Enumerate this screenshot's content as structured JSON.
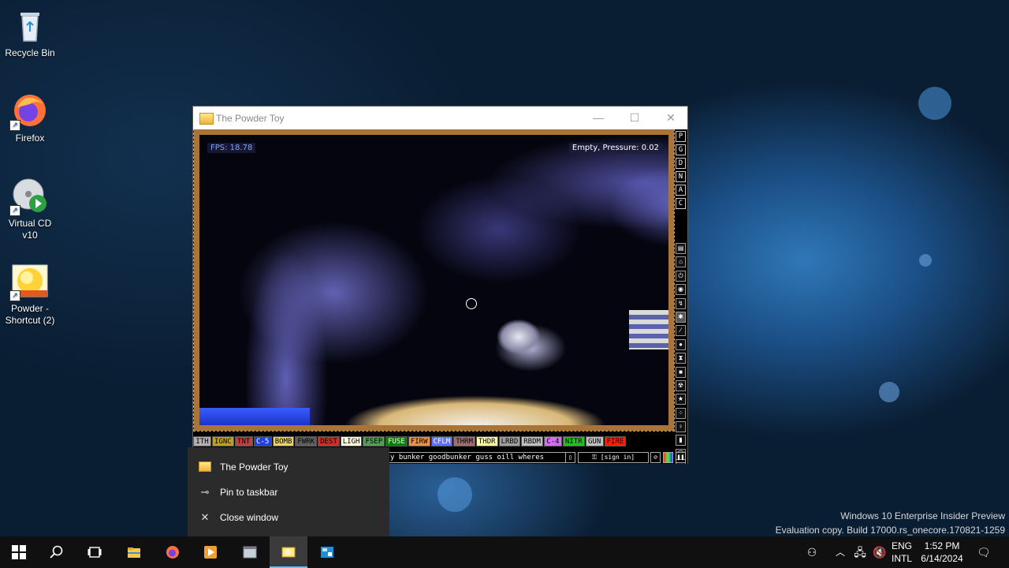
{
  "desktop": {
    "icons": [
      {
        "label": "Recycle Bin",
        "icon": "recycle-bin-icon"
      },
      {
        "label": "Firefox",
        "icon": "firefox-icon"
      },
      {
        "label": "Virtual CD v10",
        "icon": "virtual-cd-icon"
      },
      {
        "label": "Powder - Shortcut (2)",
        "icon": "powder-toy-icon"
      }
    ],
    "watermark": {
      "line1": "Windows 10 Enterprise Insider Preview",
      "line2": "Evaluation copy. Build 17000.rs_onecore.170821-1259"
    }
  },
  "window": {
    "title": "The Powder Toy",
    "controls": {
      "minimize": "—",
      "maximize": "☐",
      "close": "✕"
    }
  },
  "game": {
    "fps_label": "FPS: 18.78",
    "status_label": "Empty, Pressure: 0.02",
    "side_menu_top": [
      "P",
      "G",
      "D",
      "N",
      "A",
      "C"
    ],
    "categories": [
      "walls",
      "electronics",
      "powered",
      "sensors",
      "force",
      "explosives",
      "gases",
      "liquids",
      "powders",
      "solids",
      "radioactive",
      "special",
      "game-of-life",
      "tools",
      "favorites",
      "decorations",
      "search"
    ],
    "elements": [
      {
        "label": "ITH",
        "bg": "#b0b0b0",
        "fg": "#000000"
      },
      {
        "label": "IGNC",
        "bg": "#c0a020",
        "fg": "#000000"
      },
      {
        "label": "TNT",
        "bg": "#c04040",
        "fg": "#000000"
      },
      {
        "label": "C-5",
        "bg": "#2040e0",
        "fg": "#ffffff"
      },
      {
        "label": "BOMB",
        "bg": "#f0d060",
        "fg": "#000000"
      },
      {
        "label": "FWRK",
        "bg": "#606060",
        "fg": "#000000"
      },
      {
        "label": "DEST",
        "bg": "#d03020",
        "fg": "#000000"
      },
      {
        "label": "LIGH",
        "bg": "#ffffe0",
        "fg": "#000000"
      },
      {
        "label": "FSEP",
        "bg": "#50a050",
        "fg": "#000000"
      },
      {
        "label": "FUSE",
        "bg": "#008000",
        "fg": "#ffffff"
      },
      {
        "label": "FIRW",
        "bg": "#f09040",
        "fg": "#000000"
      },
      {
        "label": "CFLM",
        "bg": "#6070ff",
        "fg": "#ffffff"
      },
      {
        "label": "THRM",
        "bg": "#a07070",
        "fg": "#000000"
      },
      {
        "label": "THDR",
        "bg": "#ffffa0",
        "fg": "#000000"
      },
      {
        "label": "LRBD",
        "bg": "#a0a0a0",
        "fg": "#000000"
      },
      {
        "label": "RBDM",
        "bg": "#c0c0c0",
        "fg": "#000000"
      },
      {
        "label": "C-4",
        "bg": "#d070f0",
        "fg": "#000000"
      },
      {
        "label": "NITR",
        "bg": "#20c020",
        "fg": "#000000"
      },
      {
        "label": "GUN",
        "bg": "#c0c0c0",
        "fg": "#000000"
      },
      {
        "label": "FIRE",
        "bg": "#ff2000",
        "fg": "#000000"
      }
    ],
    "search_tags": "y bunker goodbunker guss oill wheres",
    "sign_in_label": "[sign in]"
  },
  "context_menu": {
    "items": [
      {
        "label": "The Powder Toy",
        "icon": "powder-toy-icon"
      },
      {
        "label": "Pin to taskbar",
        "icon": "pin-icon"
      },
      {
        "label": "Close window",
        "icon": "close-icon"
      }
    ]
  },
  "taskbar": {
    "apps": [
      "start",
      "search",
      "task-view",
      "file-explorer",
      "firefox",
      "virtual-cd",
      "app",
      "powder-toy",
      "screenshot"
    ],
    "active_app": "powder-toy",
    "language": "ENG",
    "layout": "INTL",
    "time": "1:52 PM",
    "date": "6/14/2024"
  },
  "colors": {
    "taskbar_bg": "#101010",
    "accent": "#76b9ed",
    "sim_border": "#a8743a"
  }
}
